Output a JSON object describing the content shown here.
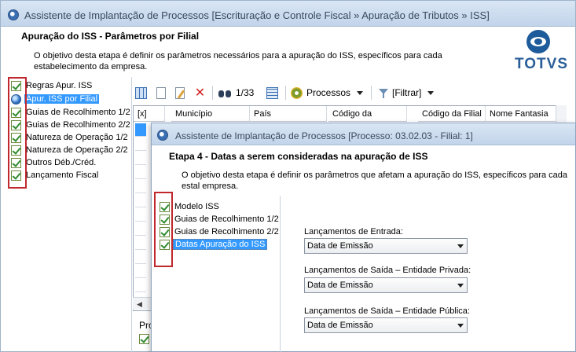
{
  "outer": {
    "title": "Assistente de Implantação de Processos [Escrituração e Controle Fiscal » Apuração de Tributos » ISS]",
    "page_title": "Apuração do ISS - Parâmetros por Filial",
    "description": "O objetivo desta etapa é definir os parâmetros necessários para a apuração do ISS, específicos para cada estabelecimento da empresa.",
    "logo_text": "TOTVS",
    "steps": [
      {
        "label": "Regras Apur. ISS",
        "icon": "check-icon"
      },
      {
        "label": "Apur. ISS por Filial",
        "icon": "globe-icon",
        "selected": true
      },
      {
        "label": "Guias de Recolhimento 1/2",
        "icon": "check-icon"
      },
      {
        "label": "Guias de Recolhimento 2/2",
        "icon": "check-icon"
      },
      {
        "label": "Natureza de Operação 1/2",
        "icon": "check-icon"
      },
      {
        "label": "Natureza de Operação 2/2",
        "icon": "check-icon"
      },
      {
        "label": "Outros Déb./Créd.",
        "icon": "check-icon"
      },
      {
        "label": "Lançamento Fiscal",
        "icon": "check-icon"
      }
    ],
    "toolbar": {
      "record_counter": "1/33",
      "processes_label": "Processos",
      "filter_label": "[Filtrar]"
    },
    "table": {
      "columns": [
        "[x]",
        "Município",
        "País",
        "Código da",
        "Código da Filial",
        "Nome Fantasia"
      ]
    },
    "bottom_label": "Pro"
  },
  "inner": {
    "title": "Assistente de Implantação de Processos [Processo: 03.02.03 - Filial: 1]",
    "page_title": "Etapa 4 - Datas a serem consideradas na apuração de ISS",
    "description": "O objetivo desta etapa é definir os parâmetros que afetam a apuração do ISS, específicos para cada estal empresa.",
    "steps": [
      {
        "label": "Modelo ISS"
      },
      {
        "label": "Guias de Recolhimento 1/2"
      },
      {
        "label": "Guias de Recolhimento 2/2"
      },
      {
        "label": "Datas Apuração do ISS",
        "selected": true
      }
    ],
    "fields": [
      {
        "label": "Lançamentos de Entrada:",
        "value": "Data de Emissão"
      },
      {
        "label": "Lançamentos de Saída – Entidade Privada:",
        "value": "Data de Emissão"
      },
      {
        "label": "Lançamentos de Saída – Entidade Pública:",
        "value": "Data de Emissão"
      }
    ]
  },
  "colors": {
    "selection": "#3399ff",
    "highlight_box": "#c0282d",
    "brand": "#2a5f99"
  }
}
